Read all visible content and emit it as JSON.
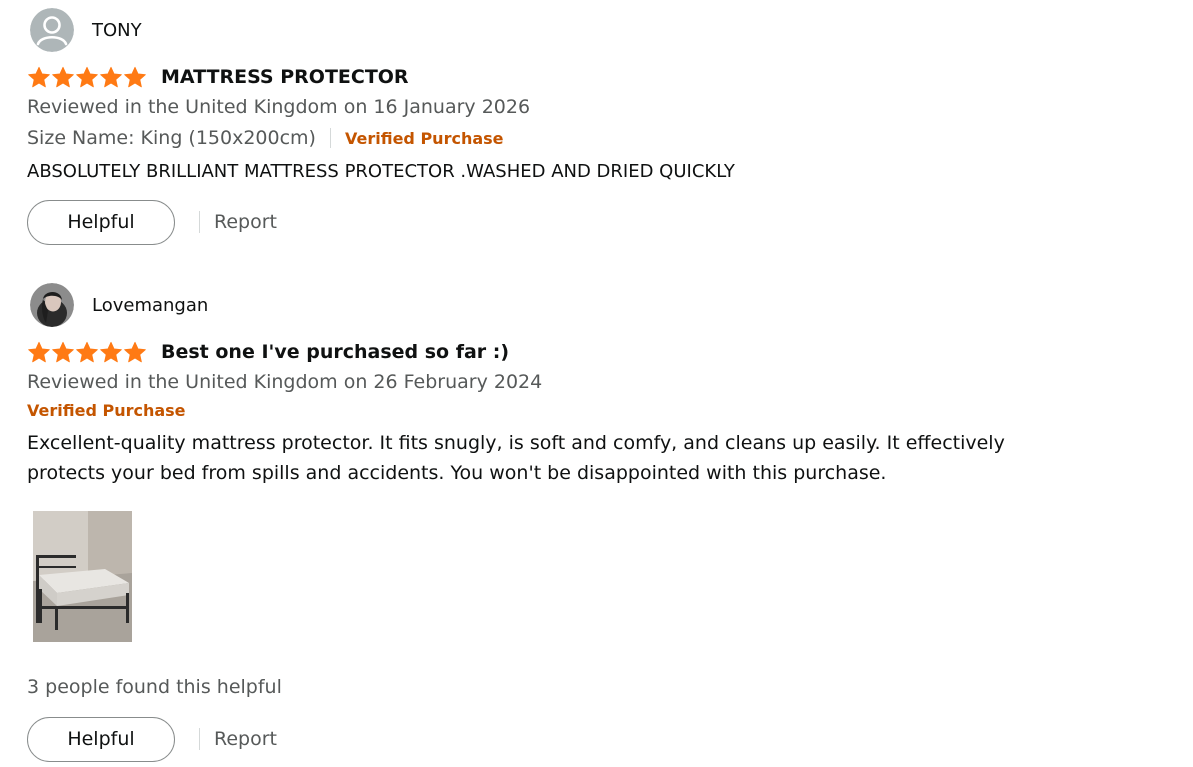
{
  "reviews": [
    {
      "profile_name": "TONY",
      "avatar": "default-avatar-icon",
      "rating": 5,
      "rating_max": 5,
      "title": "MATTRESS PROTECTOR",
      "reviewed_line": "Reviewed in the United Kingdom on 16 January 2026",
      "format": "Size Name: King (150x200cm)",
      "verified": "Verified Purchase",
      "body": "ABSOLUTELY BRILLIANT MATTRESS PROTECTOR .WASHED AND DRIED QUICKLY",
      "helpful_label": "Helpful",
      "report_label": "Report"
    },
    {
      "profile_name": "Lovemangan",
      "avatar": "user-photo-avatar",
      "rating": 5,
      "rating_max": 5,
      "title": "Best one I've purchased so far :)",
      "reviewed_line": "Reviewed in the United Kingdom on 26 February 2024",
      "verified": "Verified Purchase",
      "body_lines": [
        "Excellent-quality mattress protector. It fits snugly, is soft and comfy, and cleans up easily. It effectively",
        "protects your bed from spills and accidents. You won't be disappointed with this purchase."
      ],
      "image": "bed-photo-thumbnail",
      "helpful_count_text": "3 people found this helpful",
      "helpful_label": "Helpful",
      "report_label": "Report"
    }
  ],
  "colors": {
    "star": "#ff7a14",
    "verified": "#c45500",
    "secondary_text": "#565959",
    "primary_text": "#0f1111",
    "button_border": "#888c8c",
    "divider": "#d5d9d9"
  }
}
